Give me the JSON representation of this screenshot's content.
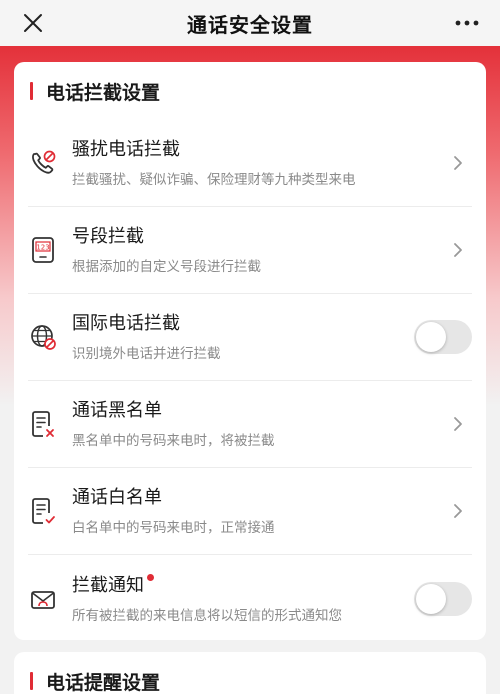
{
  "header": {
    "title": "通话安全设置"
  },
  "section1": {
    "title": "电话拦截设置",
    "items": [
      {
        "title": "骚扰电话拦截",
        "desc": "拦截骚扰、疑似诈骗、保险理财等九种类型来电",
        "control": "chevron",
        "icon": "phone-block-icon"
      },
      {
        "title": "号段拦截",
        "desc": "根据添加的自定义号段进行拦截",
        "control": "chevron",
        "icon": "number-range-icon",
        "icon_text": "123"
      },
      {
        "title": "国际电话拦截",
        "desc": "识别境外电话并进行拦截",
        "control": "toggle",
        "toggle_on": false,
        "icon": "globe-block-icon"
      },
      {
        "title": "通话黑名单",
        "desc": "黑名单中的号码来电时，将被拦截",
        "control": "chevron",
        "icon": "blacklist-icon"
      },
      {
        "title": "通话白名单",
        "desc": "白名单中的号码来电时，正常接通",
        "control": "chevron",
        "icon": "whitelist-icon"
      },
      {
        "title": "拦截通知",
        "desc": "所有被拦截的来电信息将以短信的形式通知您",
        "control": "toggle",
        "toggle_on": false,
        "icon": "notification-envelope-icon",
        "badge": true
      }
    ]
  },
  "section2": {
    "title": "电话提醒设置"
  },
  "colors": {
    "accent": "#e02c35",
    "background": "#f2f2f2",
    "card": "#ffffff",
    "toggle_off": "#e6e6e6"
  }
}
